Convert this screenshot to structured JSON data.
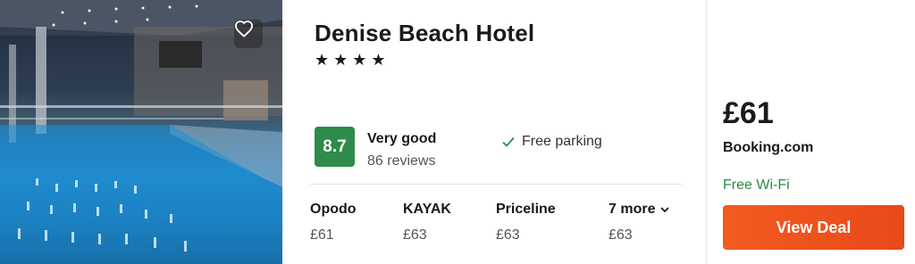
{
  "hotel": {
    "name": "Denise Beach Hotel",
    "stars": [
      "★",
      "★",
      "★",
      "★"
    ]
  },
  "rating": {
    "score": "8.7",
    "label": "Very good",
    "reviews": "86 reviews"
  },
  "amenity": {
    "label": "Free parking",
    "icon": "check-icon"
  },
  "providers": [
    {
      "name": "Opodo",
      "price": "£61"
    },
    {
      "name": "KAYAK",
      "price": "£63"
    },
    {
      "name": "Priceline",
      "price": "£63"
    },
    {
      "name": "7 more",
      "price": "£63"
    }
  ],
  "deal": {
    "price": "£61",
    "site": "Booking.com",
    "perk": "Free Wi-Fi",
    "button_label": "View Deal"
  },
  "colors": {
    "score_green": "#2e8b4a",
    "deal_orange": "#f05a1e",
    "perk_green": "#2e8b4a"
  }
}
